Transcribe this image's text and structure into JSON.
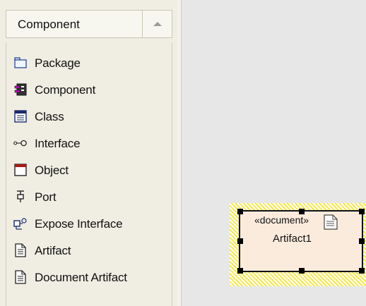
{
  "toolbox": {
    "title": "Component",
    "items": [
      {
        "label": "Package",
        "icon": "package-icon"
      },
      {
        "label": "Component",
        "icon": "component-icon"
      },
      {
        "label": "Class",
        "icon": "class-icon"
      },
      {
        "label": "Interface",
        "icon": "interface-icon"
      },
      {
        "label": "Object",
        "icon": "object-icon"
      },
      {
        "label": "Port",
        "icon": "port-icon"
      },
      {
        "label": "Expose Interface",
        "icon": "expose-interface-icon"
      },
      {
        "label": "Artifact",
        "icon": "artifact-icon"
      },
      {
        "label": "Document Artifact",
        "icon": "document-artifact-icon"
      }
    ]
  },
  "canvas": {
    "element": {
      "stereotype": "«document»",
      "name": "Artifact1",
      "icon": "document-icon",
      "fill_color": "#fbebdc",
      "selection_color": "#f5e84e"
    }
  }
}
